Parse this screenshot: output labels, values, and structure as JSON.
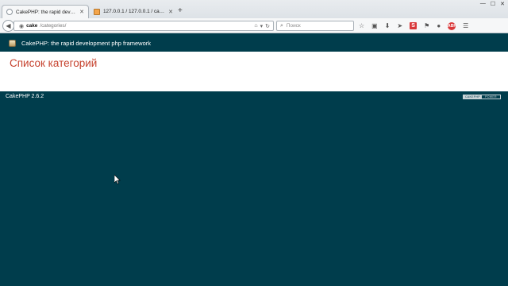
{
  "browser": {
    "tabs": [
      {
        "label": "CakePHP: the rapid develo...",
        "active": true
      },
      {
        "label": "127.0.0.1 / 127.0.0.1 / cake_...",
        "active": false
      }
    ],
    "new_tab": "+",
    "window_controls": {
      "minimize": "—",
      "maximize": "☐",
      "close": "✕"
    },
    "url": {
      "host": "cake",
      "path": "/categories/"
    },
    "search": {
      "placeholder": "Поиск"
    }
  },
  "page": {
    "header_title": "CakePHP: the rapid development php framework",
    "content_title": "Список категорий",
    "footer_version": "CakePHP 2.6.2",
    "power_badge": {
      "left": "CAKEPHP",
      "right": "POWER"
    }
  },
  "colors": {
    "cake_bg": "#003d4c",
    "title_red": "#c6422e"
  }
}
